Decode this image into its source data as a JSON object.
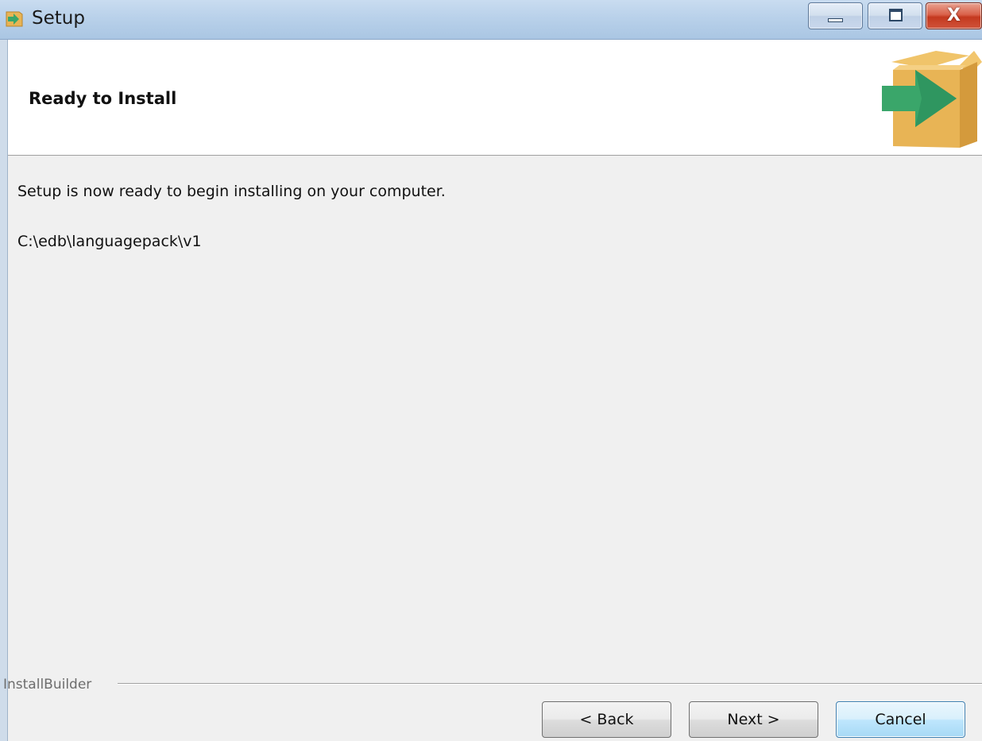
{
  "window": {
    "title": "Setup",
    "title_icon": "setup-arrow-box-icon",
    "controls": {
      "minimize_icon": "minimize-icon",
      "maximize_icon": "maximize-icon",
      "close_icon": "close-icon",
      "close_glyph": "X"
    }
  },
  "header": {
    "title": "Ready to Install",
    "logo_icon": "install-box-arrow-icon",
    "colors": {
      "box": "#e8b455",
      "arrow": "#3aa66a"
    }
  },
  "body": {
    "message": "Setup is now ready to begin installing on your computer.",
    "install_path": "C:\\edb\\languagepack\\v1"
  },
  "footer": {
    "brand": "InstallBuilder",
    "buttons": {
      "back": "< Back",
      "next": "Next >",
      "cancel": "Cancel"
    }
  }
}
